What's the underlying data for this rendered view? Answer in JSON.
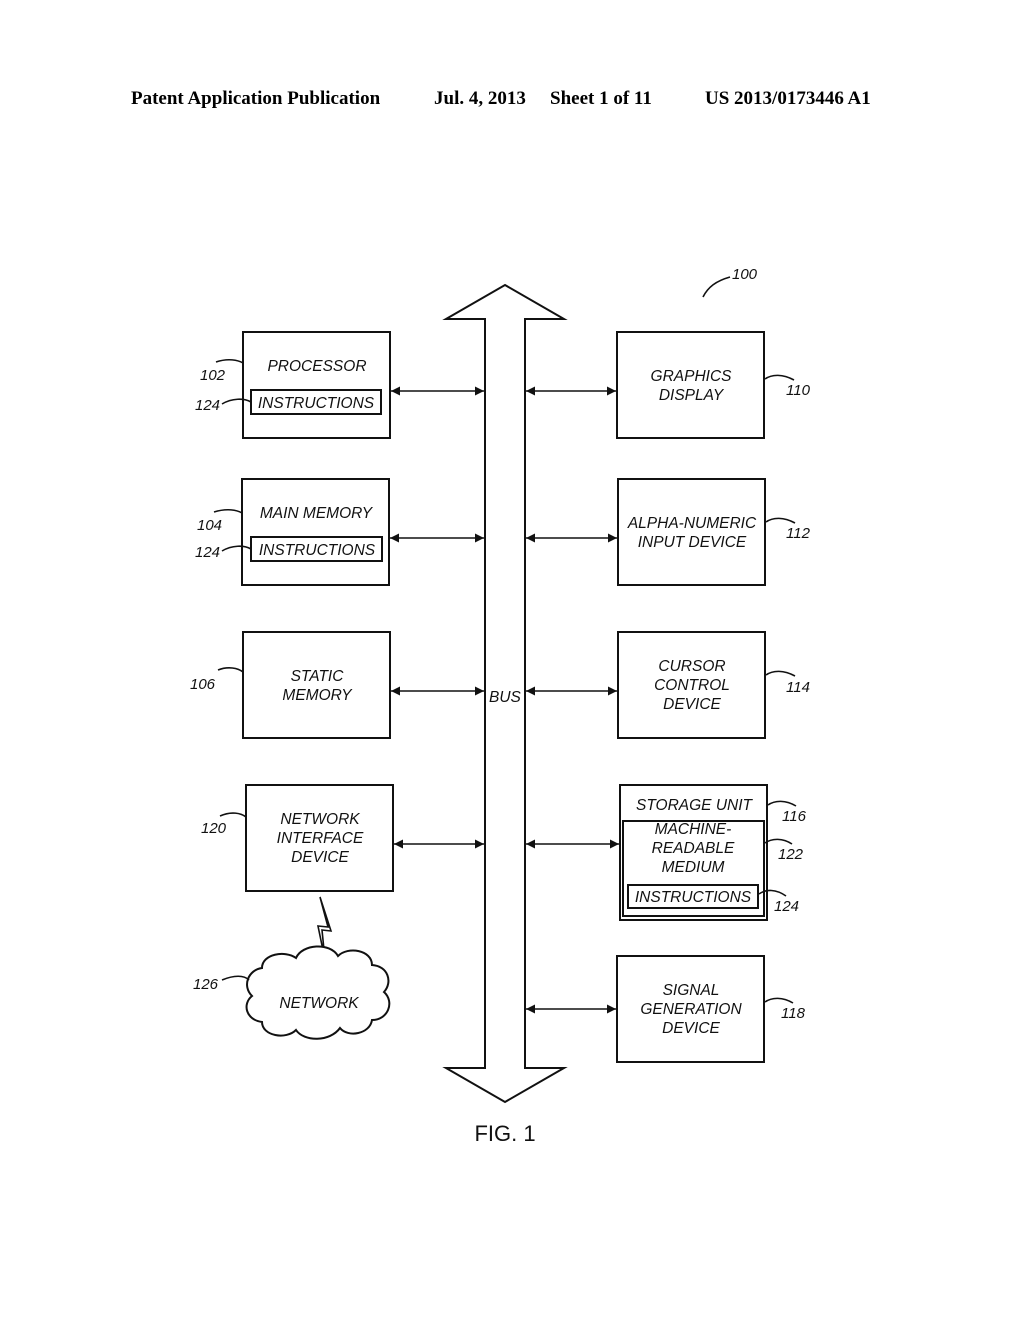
{
  "header": {
    "publication": "Patent Application Publication",
    "date": "Jul. 4, 2013",
    "sheet": "Sheet 1 of 11",
    "number": "US 2013/0173446 A1"
  },
  "figure": {
    "caption": "FIG. 1",
    "system_ref": "100",
    "bus": {
      "label": "BUS"
    },
    "blocks": {
      "processor": {
        "lines": [
          "PROCESSOR"
        ],
        "ref": "102",
        "sub": {
          "label": "INSTRUCTIONS",
          "ref": "124"
        }
      },
      "main_memory": {
        "lines": [
          "MAIN MEMORY"
        ],
        "ref": "104",
        "sub": {
          "label": "INSTRUCTIONS",
          "ref": "124"
        }
      },
      "static_memory": {
        "lines": [
          "STATIC",
          "MEMORY"
        ],
        "ref": "106"
      },
      "network_interface": {
        "lines": [
          "NETWORK",
          "INTERFACE",
          "DEVICE"
        ],
        "ref": "120"
      },
      "network": {
        "lines": [
          "NETWORK"
        ],
        "ref": "126"
      },
      "graphics_display": {
        "lines": [
          "GRAPHICS",
          "DISPLAY"
        ],
        "ref": "110"
      },
      "alpha_numeric": {
        "lines": [
          "ALPHA-NUMERIC",
          "INPUT DEVICE"
        ],
        "ref": "112"
      },
      "cursor_control": {
        "lines": [
          "CURSOR",
          "CONTROL",
          "DEVICE"
        ],
        "ref": "114"
      },
      "storage_unit": {
        "lines": [
          "STORAGE UNIT"
        ],
        "ref": "116",
        "medium": {
          "lines": [
            "MACHINE-",
            "READABLE",
            "MEDIUM"
          ],
          "ref": "122"
        },
        "sub": {
          "label": "INSTRUCTIONS",
          "ref": "124"
        }
      },
      "signal_generation": {
        "lines": [
          "SIGNAL",
          "GENERATION",
          "DEVICE"
        ],
        "ref": "118"
      }
    }
  }
}
